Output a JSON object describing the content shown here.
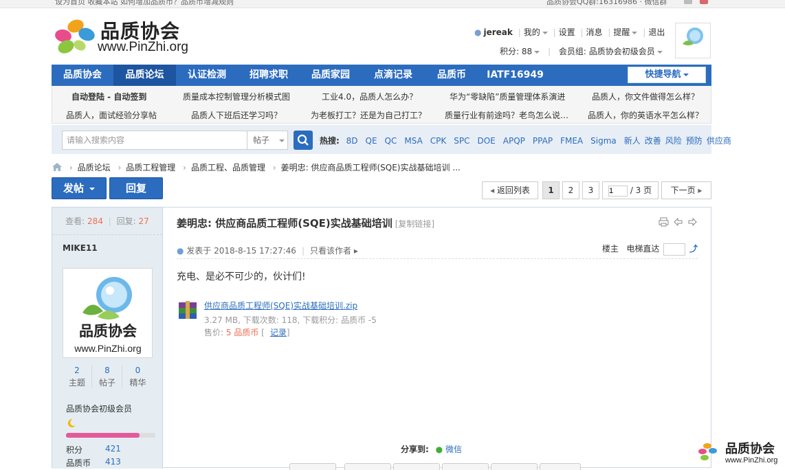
{
  "topbar": {
    "left_text": "设为首页  收藏本站  如何增加品质币？品质币增减规则",
    "right_text": "品质协会QQ群:16316986 · 微信群"
  },
  "logo": {
    "cn": "品质协会",
    "en": "www.PinZhi.org"
  },
  "user": {
    "name": "jereak",
    "mine": "我的",
    "settings": "设置",
    "messages": "消息",
    "remind": "提醒",
    "logout": "退出",
    "points": "积分: 88",
    "group": "会员组: 品质协会初级会员"
  },
  "nav": {
    "items": [
      "品质协会",
      "品质论坛",
      "认证检测",
      "招聘求职",
      "品质家园",
      "点滴记录",
      "品质币",
      "IATF16949"
    ],
    "quick": "快捷导航"
  },
  "subnav": {
    "row1": [
      "自动登陆 - 自动签到",
      "质量成本控制管理分析模式图",
      "工业4.0，品质人怎么办？",
      "华为“零缺陷”质量管理体系演进",
      "品质人，你文件做得怎么样？"
    ],
    "row2": [
      "品质人，面试经验分享帖",
      "品质人下班后还学习吗？",
      "为老板打工？还是为自己打工？",
      "质量行业有前途吗？老鸟怎么说…",
      "品质人，你的英语水平怎么样？"
    ]
  },
  "search": {
    "placeholder": "请输入搜索内容",
    "type": "帖子",
    "hot_label": "热搜:",
    "hot": [
      "8D",
      "QE",
      "QC",
      "MSA",
      "CPK",
      "SPC",
      "DOE",
      "APQP",
      "PPAP",
      "FMEA",
      "Sigma",
      "新人",
      "改善",
      "风险",
      "预防",
      "供应商"
    ]
  },
  "breadcrumb": [
    "品质论坛",
    "品质工程管理",
    "品质工程、品质管理",
    "姜明忠: 供应商品质工程师(SQE)实战基础培训 ..."
  ],
  "actions": {
    "post": "发帖",
    "reply": "回复"
  },
  "pager": {
    "back": "返回列表",
    "pages": [
      "1",
      "2",
      "3"
    ],
    "input": "1",
    "total": "/ 3 页",
    "next": "下一页"
  },
  "author": {
    "views_label": "查看:",
    "views": "284",
    "replies_label": "回复:",
    "replies": "27",
    "name": "MIKE11",
    "topics": "2",
    "topics_label": "主题",
    "posts": "8",
    "posts_label": "帖子",
    "digest": "0",
    "digest_label": "精华",
    "group": "品质协会初级会员",
    "level_fraction": 0.82,
    "points_label": "积分",
    "points": "421",
    "coins_label": "品质币",
    "coins": "413"
  },
  "thread": {
    "title": "姜明忠: 供应商品质工程师(SQE)实战基础培训",
    "copy_link": "[复制链接]",
    "posted": "发表于 2018-8-15 17:27:46",
    "only_author": "只看该作者",
    "floor": "楼主",
    "jump": "电梯直达",
    "body": "充电、是必不可少的，伙计们!"
  },
  "attachment": {
    "filename": "供应商品质工程师(SQE)实战基础培训.zip",
    "info": "3.27 MB, 下载次数: 118, 下载积分: 品质币 -5",
    "price_label": "售价:",
    "price": "5 品质币",
    "record": "记录"
  },
  "share": {
    "label": "分享到:",
    "wechat": "微信"
  },
  "watermark": {
    "cn": "品质协会",
    "en": "www.PinZhi.org"
  }
}
